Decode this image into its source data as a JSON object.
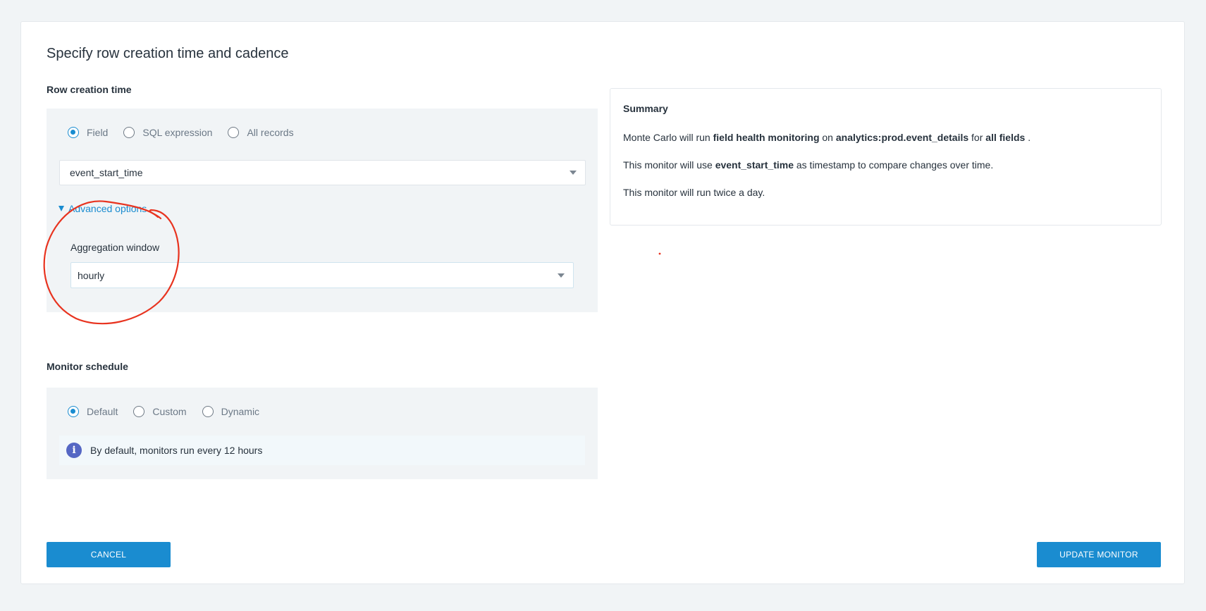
{
  "page": {
    "title": "Specify row creation time and cadence"
  },
  "row_creation": {
    "section_label": "Row creation time",
    "options": [
      {
        "label": "Field",
        "selected": true
      },
      {
        "label": "SQL expression",
        "selected": false
      },
      {
        "label": "All records",
        "selected": false
      }
    ],
    "field_value": "event_start_time",
    "advanced_toggle_label": "Advanced options",
    "aggregation_label": "Aggregation window",
    "aggregation_value": "hourly"
  },
  "schedule": {
    "section_label": "Monitor schedule",
    "options": [
      {
        "label": "Default",
        "selected": true
      },
      {
        "label": "Custom",
        "selected": false
      },
      {
        "label": "Dynamic",
        "selected": false
      }
    ],
    "info_text": "By default, monitors run every 12 hours",
    "info_icon": "info-icon"
  },
  "summary": {
    "title": "Summary",
    "line1": {
      "p1": "Monte Carlo will run ",
      "b1": "field health monitoring",
      "p2": " on ",
      "b2": "analytics:prod.event_details",
      "p3": " for ",
      "b3": "all fields",
      "p4": " ."
    },
    "line2": {
      "p1": "This monitor will use ",
      "b1": "event_start_time",
      "p2": " as timestamp to compare changes over time."
    },
    "line3": "This monitor will run twice a day."
  },
  "buttons": {
    "cancel": "CANCEL",
    "update": "UPDATE MONITOR"
  },
  "colors": {
    "accent": "#1a8cd0",
    "annotation": "#e8331f",
    "info_icon_bg": "#5567c4"
  }
}
